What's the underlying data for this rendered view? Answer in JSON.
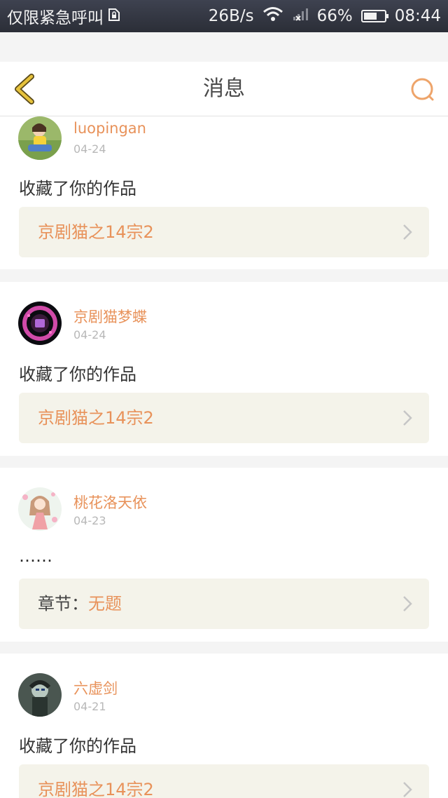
{
  "status_bar": {
    "carrier": "仅限紧急呼叫",
    "net_speed": "26B/s",
    "battery": "66%",
    "battery_level": 0.66,
    "time": "08:44"
  },
  "header": {
    "title": "消息"
  },
  "messages": [
    {
      "username": "luopingan",
      "date": "04-24",
      "text": "收藏了你的作品",
      "ref_prefix": "",
      "ref_title": "京剧猫之14宗2"
    },
    {
      "username": "京剧猫梦蝶",
      "date": "04-24",
      "text": "收藏了你的作品",
      "ref_prefix": "",
      "ref_title": "京剧猫之14宗2"
    },
    {
      "username": "桃花洛天依",
      "date": "04-23",
      "text": "……",
      "ref_prefix": "章节：",
      "ref_title": "无题"
    },
    {
      "username": "六虚剑",
      "date": "04-21",
      "text": "收藏了你的作品",
      "ref_prefix": "",
      "ref_title": "京剧猫之14宗2"
    }
  ],
  "colors": {
    "accent": "#e8925a",
    "back_arrow": "#e6c23c",
    "ref_background": "#f4f3ea"
  }
}
